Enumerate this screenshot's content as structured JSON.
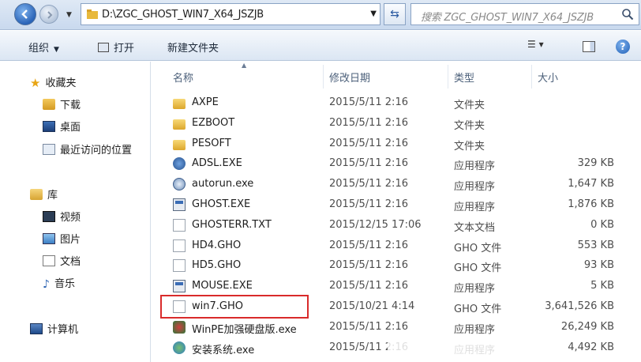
{
  "addressbar": {
    "path": "D:\\ZGC_GHOST_WIN7_X64_JSZJB",
    "search_placeholder": "搜索 ZGC_GHOST_WIN7_X64_JSZJB"
  },
  "toolbar": {
    "organize": "组织",
    "open": "打开",
    "new_folder": "新建文件夹"
  },
  "nav": {
    "favorites": "收藏夹",
    "downloads": "下载",
    "desktop": "桌面",
    "recent": "最近访问的位置",
    "libraries": "库",
    "videos": "视频",
    "pictures": "图片",
    "documents": "文档",
    "music": "音乐",
    "computer": "计算机"
  },
  "columns": {
    "name": "名称",
    "date": "修改日期",
    "type": "类型",
    "size": "大小"
  },
  "files": [
    {
      "name": "AXPE",
      "date": "2015/5/11 2:16",
      "type": "文件夹",
      "size": ""
    },
    {
      "name": "EZBOOT",
      "date": "2015/5/11 2:16",
      "type": "文件夹",
      "size": ""
    },
    {
      "name": "PESOFT",
      "date": "2015/5/11 2:16",
      "type": "文件夹",
      "size": ""
    },
    {
      "name": "ADSL.EXE",
      "date": "2015/5/11 2:16",
      "type": "应用程序",
      "size": "329 KB"
    },
    {
      "name": "autorun.exe",
      "date": "2015/5/11 2:16",
      "type": "应用程序",
      "size": "1,647 KB"
    },
    {
      "name": "GHOST.EXE",
      "date": "2015/5/11 2:16",
      "type": "应用程序",
      "size": "1,876 KB"
    },
    {
      "name": "GHOSTERR.TXT",
      "date": "2015/12/15 17:06",
      "type": "文本文档",
      "size": "0 KB"
    },
    {
      "name": "HD4.GHO",
      "date": "2015/5/11 2:16",
      "type": "GHO 文件",
      "size": "553 KB"
    },
    {
      "name": "HD5.GHO",
      "date": "2015/5/11 2:16",
      "type": "GHO 文件",
      "size": "93 KB"
    },
    {
      "name": "MOUSE.EXE",
      "date": "2015/5/11 2:16",
      "type": "应用程序",
      "size": "5 KB"
    },
    {
      "name": "win7.GHO",
      "date": "2015/10/21 4:14",
      "type": "GHO 文件",
      "size": "3,641,526 KB"
    },
    {
      "name": "WinPE加强硬盘版.exe",
      "date": "2015/5/11 2:16",
      "type": "应用程序",
      "size": "26,249 KB"
    },
    {
      "name": "安装系统.exe",
      "date": "2015/5/11 2:16",
      "type": "应用程序",
      "size": "4,492 KB"
    }
  ]
}
